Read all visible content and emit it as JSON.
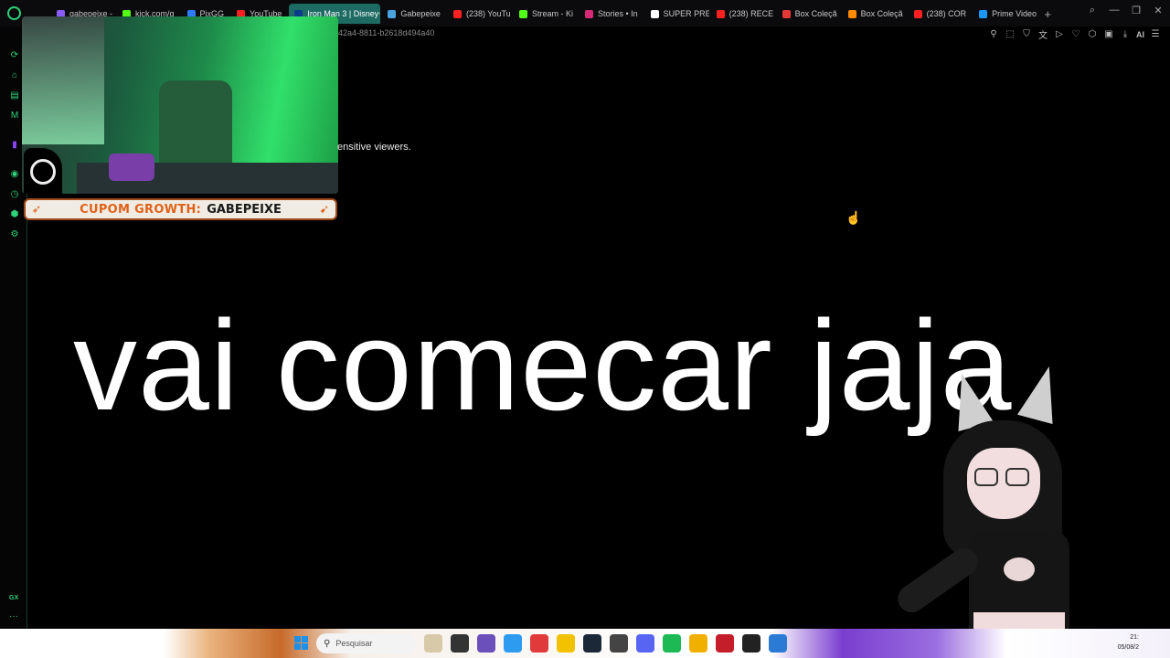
{
  "browser": {
    "tabs": [
      {
        "label": "gabepeixe -",
        "color": "#8a5cf6"
      },
      {
        "label": "kick.com/g",
        "color": "#53fc18"
      },
      {
        "label": "PixGG",
        "color": "#2e7bff"
      },
      {
        "label": "YouTube",
        "color": "#ff2020"
      },
      {
        "label": "Iron Man 3 | Disney+",
        "color": "#0b3e8a",
        "active": true
      },
      {
        "label": "Gabepeixe",
        "color": "#4aa3df"
      },
      {
        "label": "(238) YouTu",
        "color": "#ff2020"
      },
      {
        "label": "Stream - Ki",
        "color": "#53fc18"
      },
      {
        "label": "Stories • In",
        "color": "#d62976"
      },
      {
        "label": "SUPER PRE",
        "color": "#ffffff"
      },
      {
        "label": "(238) RECE",
        "color": "#ff2020"
      },
      {
        "label": "Box Coleçã",
        "color": "#e53935"
      },
      {
        "label": "Box Coleçã",
        "color": "#ff8a00"
      },
      {
        "label": "(238) COR",
        "color": "#ff2020"
      },
      {
        "label": "Prime Video",
        "color": "#1a98ff"
      }
    ],
    "new_tab": "+",
    "address_fragment": "42a4-8811-b2618d494a40",
    "ai_label": "AI"
  },
  "overlay": {
    "sensitive_text": "ensitive viewers.",
    "coupon_prefix": "CUPOM GROWTH:",
    "coupon_code": "GABEPEIXE"
  },
  "main": {
    "headline": "vai comecar jaja"
  },
  "sidebar": {
    "gx_label": "GX",
    "more": "···"
  },
  "taskbar": {
    "search_placeholder": "Pesquisar",
    "time": "21:",
    "date": "05/08/2"
  }
}
